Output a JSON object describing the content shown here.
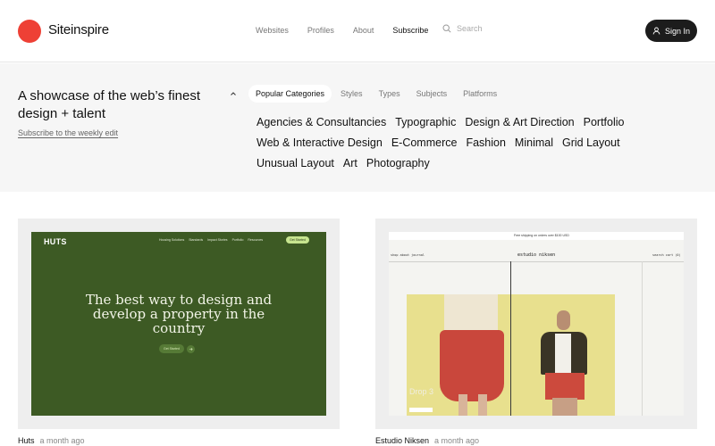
{
  "header": {
    "brand": "Siteinspire",
    "nav": [
      "Websites",
      "Profiles",
      "About",
      "Subscribe"
    ],
    "active_nav": "Subscribe",
    "search_placeholder": "Search",
    "signin_label": "Sign In",
    "brand_color": "#ee4035"
  },
  "hero": {
    "tagline": "A showcase of the web’s finest design + talent",
    "subscribe_link": "Subscribe to the weekly edit",
    "tabs": [
      "Popular Categories",
      "Styles",
      "Types",
      "Subjects",
      "Platforms"
    ],
    "active_tab": "Popular Categories",
    "categories": [
      "Agencies & Consultancies",
      "Typographic",
      "Design & Art Direction",
      "Portfolio",
      "Web & Interactive Design",
      "E-Commerce",
      "Fashion",
      "Minimal",
      "Grid Layout",
      "Unusual Layout",
      "Art",
      "Photography"
    ]
  },
  "cards": [
    {
      "name": "Huts",
      "time": "a month ago",
      "preview": {
        "logo": "HUTS",
        "nav": [
          "Housing Solutions",
          "Standards",
          "Impact Stories",
          "Portfolio",
          "Resources"
        ],
        "cta": "Get Started",
        "headline": "The best way to design and develop a property in the country",
        "button": "Get Started",
        "bg_color": "#3d5a24"
      }
    },
    {
      "name": "Estudio Niksen",
      "time": "a month ago",
      "preview": {
        "promo": "Free shipping on orders over $100 USD",
        "nav_left": "shop  about  journal",
        "logo": "estudio niksen",
        "nav_right": "search  cart (0)",
        "drop_text": "Drop 3"
      }
    }
  ]
}
